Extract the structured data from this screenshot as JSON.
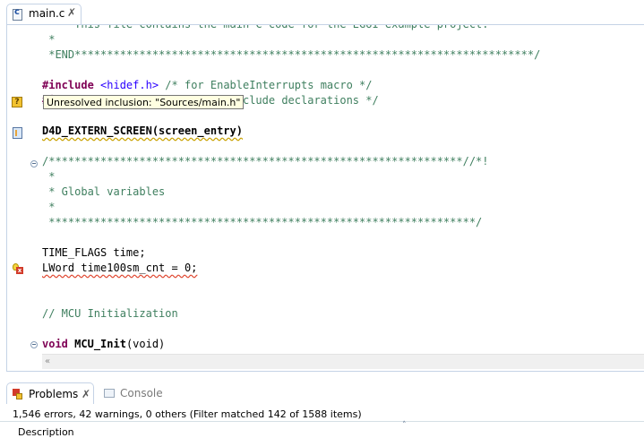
{
  "editor": {
    "tab": {
      "label": "main.c",
      "icon": "c-source-file-icon",
      "close": "✗"
    },
    "lines": [
      {
        "text": " *   This file contains the main C code for the EGUI example project.",
        "cls": "cm"
      },
      {
        "text": " *",
        "cls": "cm"
      },
      {
        "text": " *END***********************************************************************/",
        "cls": "cm"
      },
      {
        "text": "",
        "cls": ""
      },
      {
        "text": "#include <hidef.h> /* for EnableInterrupts macro */",
        "cls": "include"
      },
      {
        "text": "#include \"Sources/main.h\" /* include declarations */",
        "cls": "include2"
      },
      {
        "text": "",
        "cls": ""
      },
      {
        "text": "D4D_EXTERN_SCREEN(screen_entry)",
        "cls": "macro"
      },
      {
        "text": "",
        "cls": ""
      },
      {
        "text": "/****************************************************************//*!",
        "cls": "cm"
      },
      {
        "text": " *",
        "cls": "cm"
      },
      {
        "text": " * Global variables",
        "cls": "cm"
      },
      {
        "text": " *",
        "cls": "cm"
      },
      {
        "text": " ******************************************************************/",
        "cls": "cm"
      },
      {
        "text": "",
        "cls": ""
      },
      {
        "text": "TIME_FLAGS time;",
        "cls": "plain"
      },
      {
        "text": "LWord time100sm_cnt = 0;",
        "cls": "plain"
      },
      {
        "text": "",
        "cls": ""
      },
      {
        "text": "",
        "cls": ""
      },
      {
        "text": "// MCU Initialization",
        "cls": "cm"
      },
      {
        "text": "",
        "cls": ""
      },
      {
        "text": "void MCU_Init(void)",
        "cls": "kw"
      }
    ],
    "tooltip": "Unresolved inclusion: \"Sources/main.h\"",
    "scroll_left": "«"
  },
  "problems": {
    "tab_label": "Problems",
    "tab_close": "✗",
    "console_label": "Console",
    "summary": "1,546 errors, 42 warnings, 0 others (Filter matched 142 of 1588 items)",
    "column_description": "Description",
    "sort_indicator": "˄"
  },
  "colors": {
    "comment": "#3f7f5f",
    "keyword": "#7f0055",
    "string": "#2a00ff",
    "tooltip_bg": "#ffffe1",
    "tab_border": "#c5d3e6"
  }
}
